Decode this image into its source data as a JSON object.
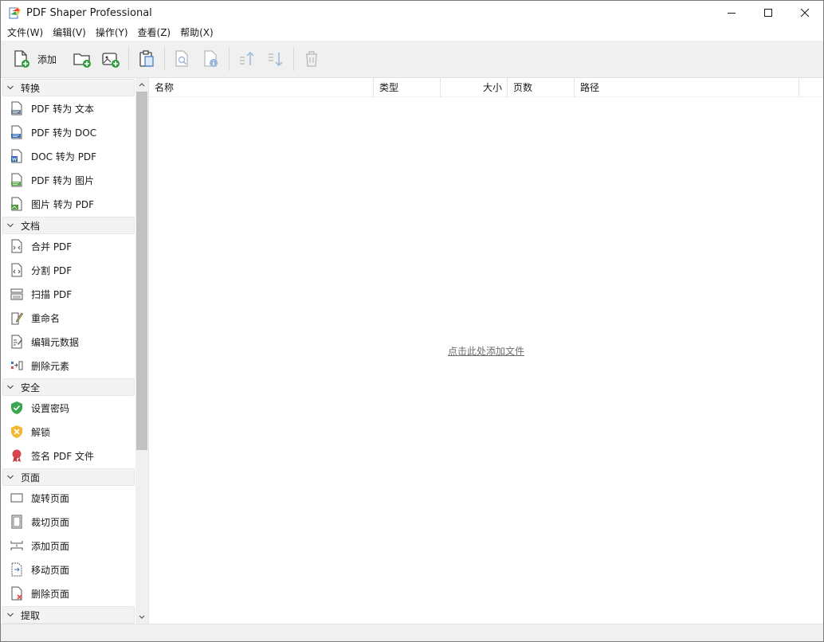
{
  "window": {
    "title": "PDF Shaper Professional"
  },
  "menu": [
    "文件(W)",
    "编辑(V)",
    "操作(Y)",
    "查看(Z)",
    "帮助(X)"
  ],
  "toolbar": {
    "add_label": "添加"
  },
  "sidebar": {
    "sections": [
      {
        "label": "转换",
        "items": [
          {
            "label": "PDF 转为 文本",
            "icon": "txt-file-icon"
          },
          {
            "label": "PDF 转为 DOC",
            "icon": "doc-file-icon"
          },
          {
            "label": "DOC 转为 PDF",
            "icon": "word-file-icon"
          },
          {
            "label": "PDF 转为 图片",
            "icon": "jpg-file-icon"
          },
          {
            "label": "图片 转为 PDF",
            "icon": "image-file-icon"
          }
        ]
      },
      {
        "label": "文档",
        "items": [
          {
            "label": "合并 PDF",
            "icon": "merge-icon"
          },
          {
            "label": "分割 PDF",
            "icon": "split-icon"
          },
          {
            "label": "扫描 PDF",
            "icon": "scanner-icon"
          },
          {
            "label": "重命名",
            "icon": "rename-icon"
          },
          {
            "label": "编辑元数据",
            "icon": "metadata-icon"
          },
          {
            "label": "删除元素",
            "icon": "remove-elements-icon"
          }
        ]
      },
      {
        "label": "安全",
        "items": [
          {
            "label": "设置密码",
            "icon": "shield-icon"
          },
          {
            "label": "解锁",
            "icon": "unlock-shield-icon"
          },
          {
            "label": "签名 PDF 文件",
            "icon": "seal-icon"
          }
        ]
      },
      {
        "label": "页面",
        "items": [
          {
            "label": "旋转页面",
            "icon": "rotate-page-icon"
          },
          {
            "label": "裁切页面",
            "icon": "crop-page-icon"
          },
          {
            "label": "添加页面",
            "icon": "add-page-icon"
          },
          {
            "label": "移动页面",
            "icon": "move-page-icon"
          },
          {
            "label": "删除页面",
            "icon": "delete-page-icon"
          }
        ]
      },
      {
        "label": "提取",
        "items": []
      }
    ]
  },
  "filelist": {
    "columns": [
      "名称",
      "类型",
      "大小",
      "页数",
      "路径"
    ],
    "empty_hint": "点击此处添加文件"
  }
}
